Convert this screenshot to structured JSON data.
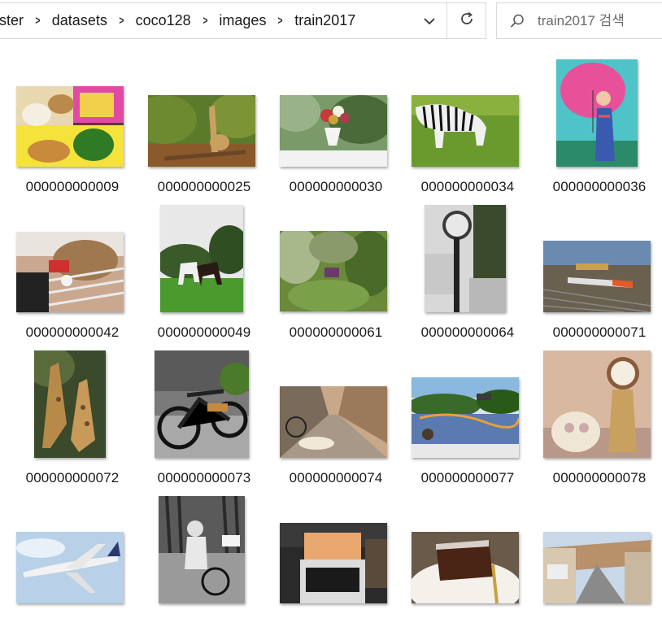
{
  "breadcrumb": [
    "ster",
    "datasets",
    "coco128",
    "images",
    "train2017"
  ],
  "search": {
    "placeholder": "train2017 검색"
  },
  "icons": {
    "separator": "chevron-right-icon",
    "dropdown": "chevron-down-icon",
    "refresh": "refresh-icon",
    "search": "search-icon"
  },
  "files": [
    {
      "name": "000000000009",
      "scene": "lunchbox"
    },
    {
      "name": "000000000025",
      "scene": "giraffe"
    },
    {
      "name": "000000000030",
      "scene": "flower vase"
    },
    {
      "name": "000000000034",
      "scene": "zebra"
    },
    {
      "name": "000000000036",
      "scene": "umbrella"
    },
    {
      "name": "000000000042",
      "scene": "dog"
    },
    {
      "name": "000000000049",
      "scene": "horses"
    },
    {
      "name": "000000000061",
      "scene": "forest"
    },
    {
      "name": "000000000064",
      "scene": "clock"
    },
    {
      "name": "000000000071",
      "scene": "train"
    },
    {
      "name": "000000000072",
      "scene": "giraffes"
    },
    {
      "name": "000000000073",
      "scene": "motorcycle"
    },
    {
      "name": "000000000074",
      "scene": "street dog"
    },
    {
      "name": "000000000077",
      "scene": "skateboard"
    },
    {
      "name": "000000000078",
      "scene": "clock"
    },
    {
      "name": "",
      "scene": "airplane"
    },
    {
      "name": "",
      "scene": "bicycle"
    },
    {
      "name": "",
      "scene": "oven"
    },
    {
      "name": "",
      "scene": "cake"
    },
    {
      "name": "",
      "scene": "street"
    }
  ]
}
